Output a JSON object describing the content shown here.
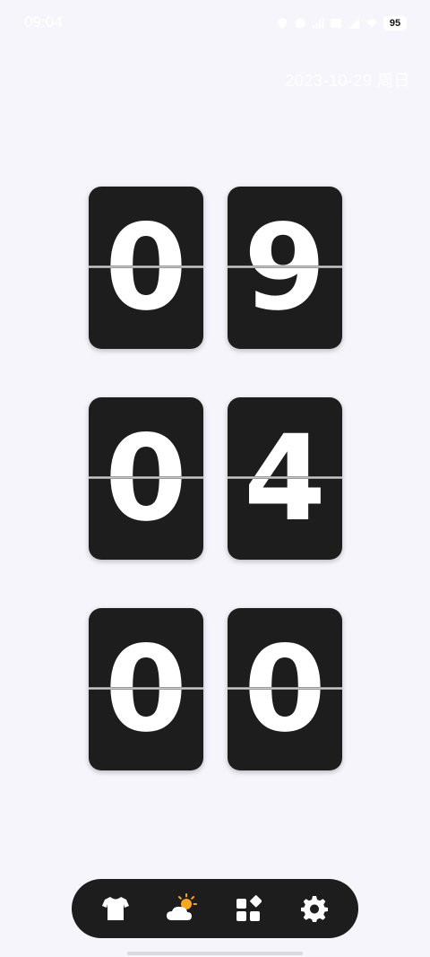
{
  "status_bar": {
    "time": "09:04",
    "battery": "95"
  },
  "date": "2023-10-29  周日",
  "clock": {
    "hours": [
      "0",
      "9"
    ],
    "minutes": [
      "0",
      "4"
    ],
    "seconds": [
      "0",
      "0"
    ]
  },
  "bottom_nav": {
    "items": [
      {
        "icon": "shirt-icon"
      },
      {
        "icon": "weather-icon"
      },
      {
        "icon": "widgets-icon"
      },
      {
        "icon": "gear-icon"
      }
    ]
  },
  "colors": {
    "background": "#f6f5fb",
    "card": "#1d1d1d",
    "digit": "#ffffff",
    "sun": "#f5a623"
  }
}
